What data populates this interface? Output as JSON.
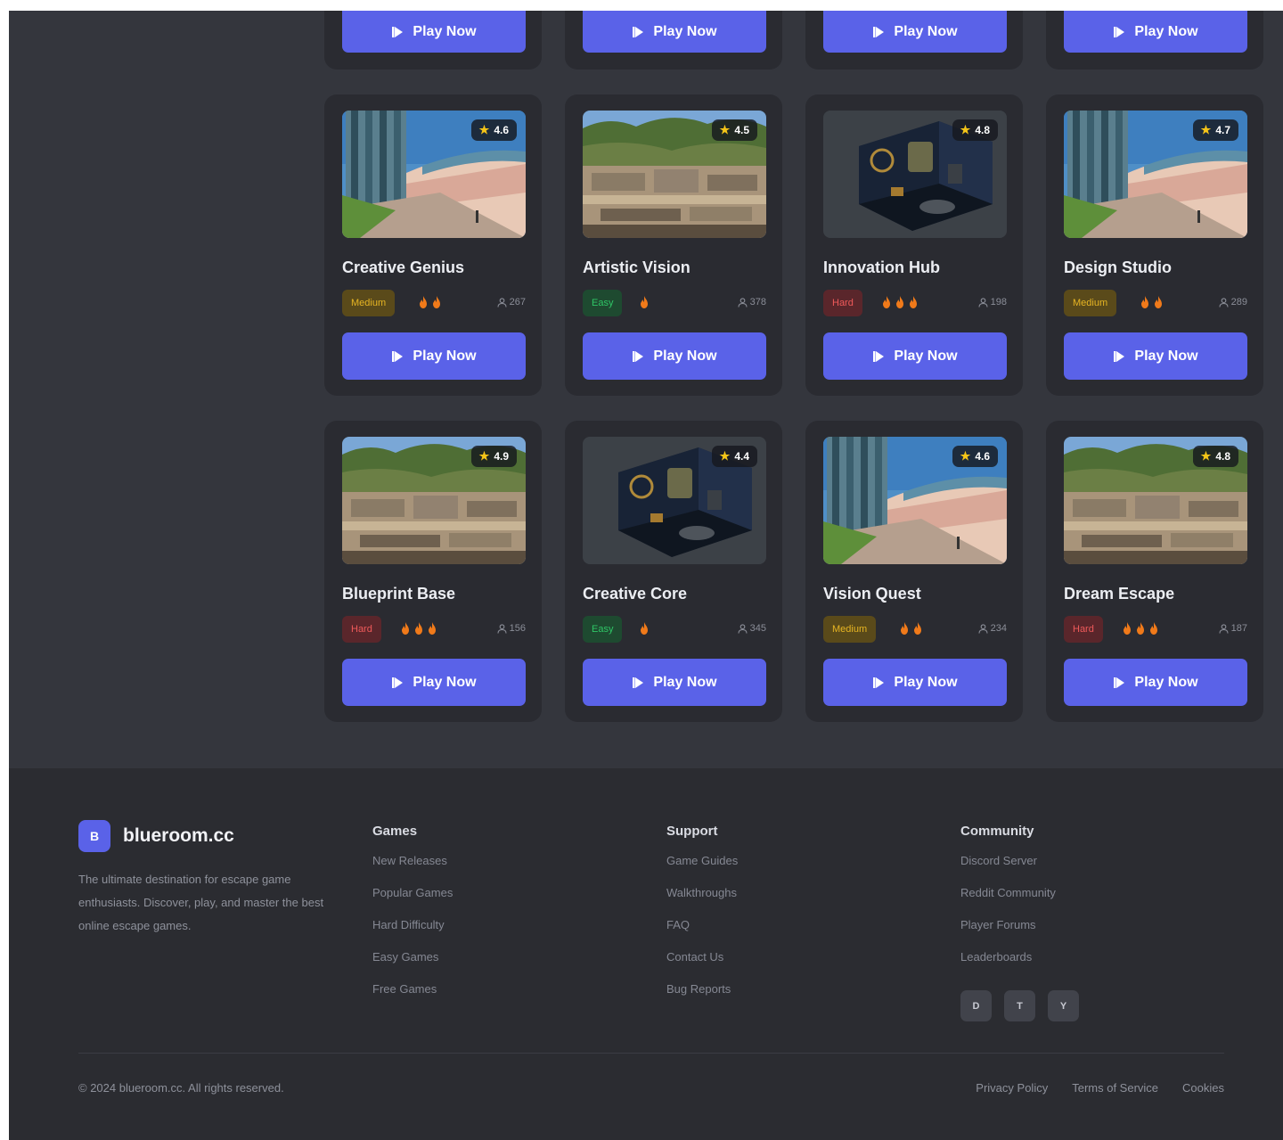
{
  "play_label": "Play Now",
  "partial_cards": [
    {
      "play_label": "Play Now"
    },
    {
      "play_label": "Play Now"
    },
    {
      "play_label": "Play Now"
    },
    {
      "play_label": "Play Now"
    }
  ],
  "rows": [
    [
      {
        "title": "Creative Genius",
        "rating": "4.6",
        "difficulty": "Medium",
        "difficulty_level": 2,
        "players": "267",
        "image": "stadium"
      },
      {
        "title": "Artistic Vision",
        "rating": "4.5",
        "difficulty": "Easy",
        "difficulty_level": 1,
        "players": "378",
        "image": "ruins"
      },
      {
        "title": "Innovation Hub",
        "rating": "4.8",
        "difficulty": "Hard",
        "difficulty_level": 3,
        "players": "198",
        "image": "room"
      },
      {
        "title": "Design Studio",
        "rating": "4.7",
        "difficulty": "Medium",
        "difficulty_level": 2,
        "players": "289",
        "image": "stadium"
      }
    ],
    [
      {
        "title": "Blueprint Base",
        "rating": "4.9",
        "difficulty": "Hard",
        "difficulty_level": 3,
        "players": "156",
        "image": "ruins"
      },
      {
        "title": "Creative Core",
        "rating": "4.4",
        "difficulty": "Easy",
        "difficulty_level": 1,
        "players": "345",
        "image": "room"
      },
      {
        "title": "Vision Quest",
        "rating": "4.6",
        "difficulty": "Medium",
        "difficulty_level": 2,
        "players": "234",
        "image": "stadium"
      },
      {
        "title": "Dream Escape",
        "rating": "4.8",
        "difficulty": "Hard",
        "difficulty_level": 3,
        "players": "187",
        "image": "ruins"
      }
    ]
  ],
  "footer": {
    "logo_letter": "B",
    "brand": "blueroom.cc",
    "description": "The ultimate destination for escape game enthusiasts. Discover, play, and master the best online escape games.",
    "columns": [
      {
        "title": "Games",
        "links": [
          "New Releases",
          "Popular Games",
          "Hard Difficulty",
          "Easy Games",
          "Free Games"
        ]
      },
      {
        "title": "Support",
        "links": [
          "Game Guides",
          "Walkthroughs",
          "FAQ",
          "Contact Us",
          "Bug Reports"
        ]
      },
      {
        "title": "Community",
        "links": [
          "Discord Server",
          "Reddit Community",
          "Player Forums",
          "Leaderboards"
        ]
      }
    ],
    "socials": [
      "D",
      "T",
      "Y"
    ],
    "copyright": "© 2024 blueroom.cc. All rights reserved.",
    "legal": [
      "Privacy Policy",
      "Terms of Service",
      "Cookies"
    ]
  },
  "colors": {
    "accent": "#5a62e8",
    "page_bg": "#34363d",
    "card_bg": "#2a2b31",
    "footer_bg": "#2b2c31",
    "star": "#f5c518",
    "flame": "#f07a1a"
  }
}
